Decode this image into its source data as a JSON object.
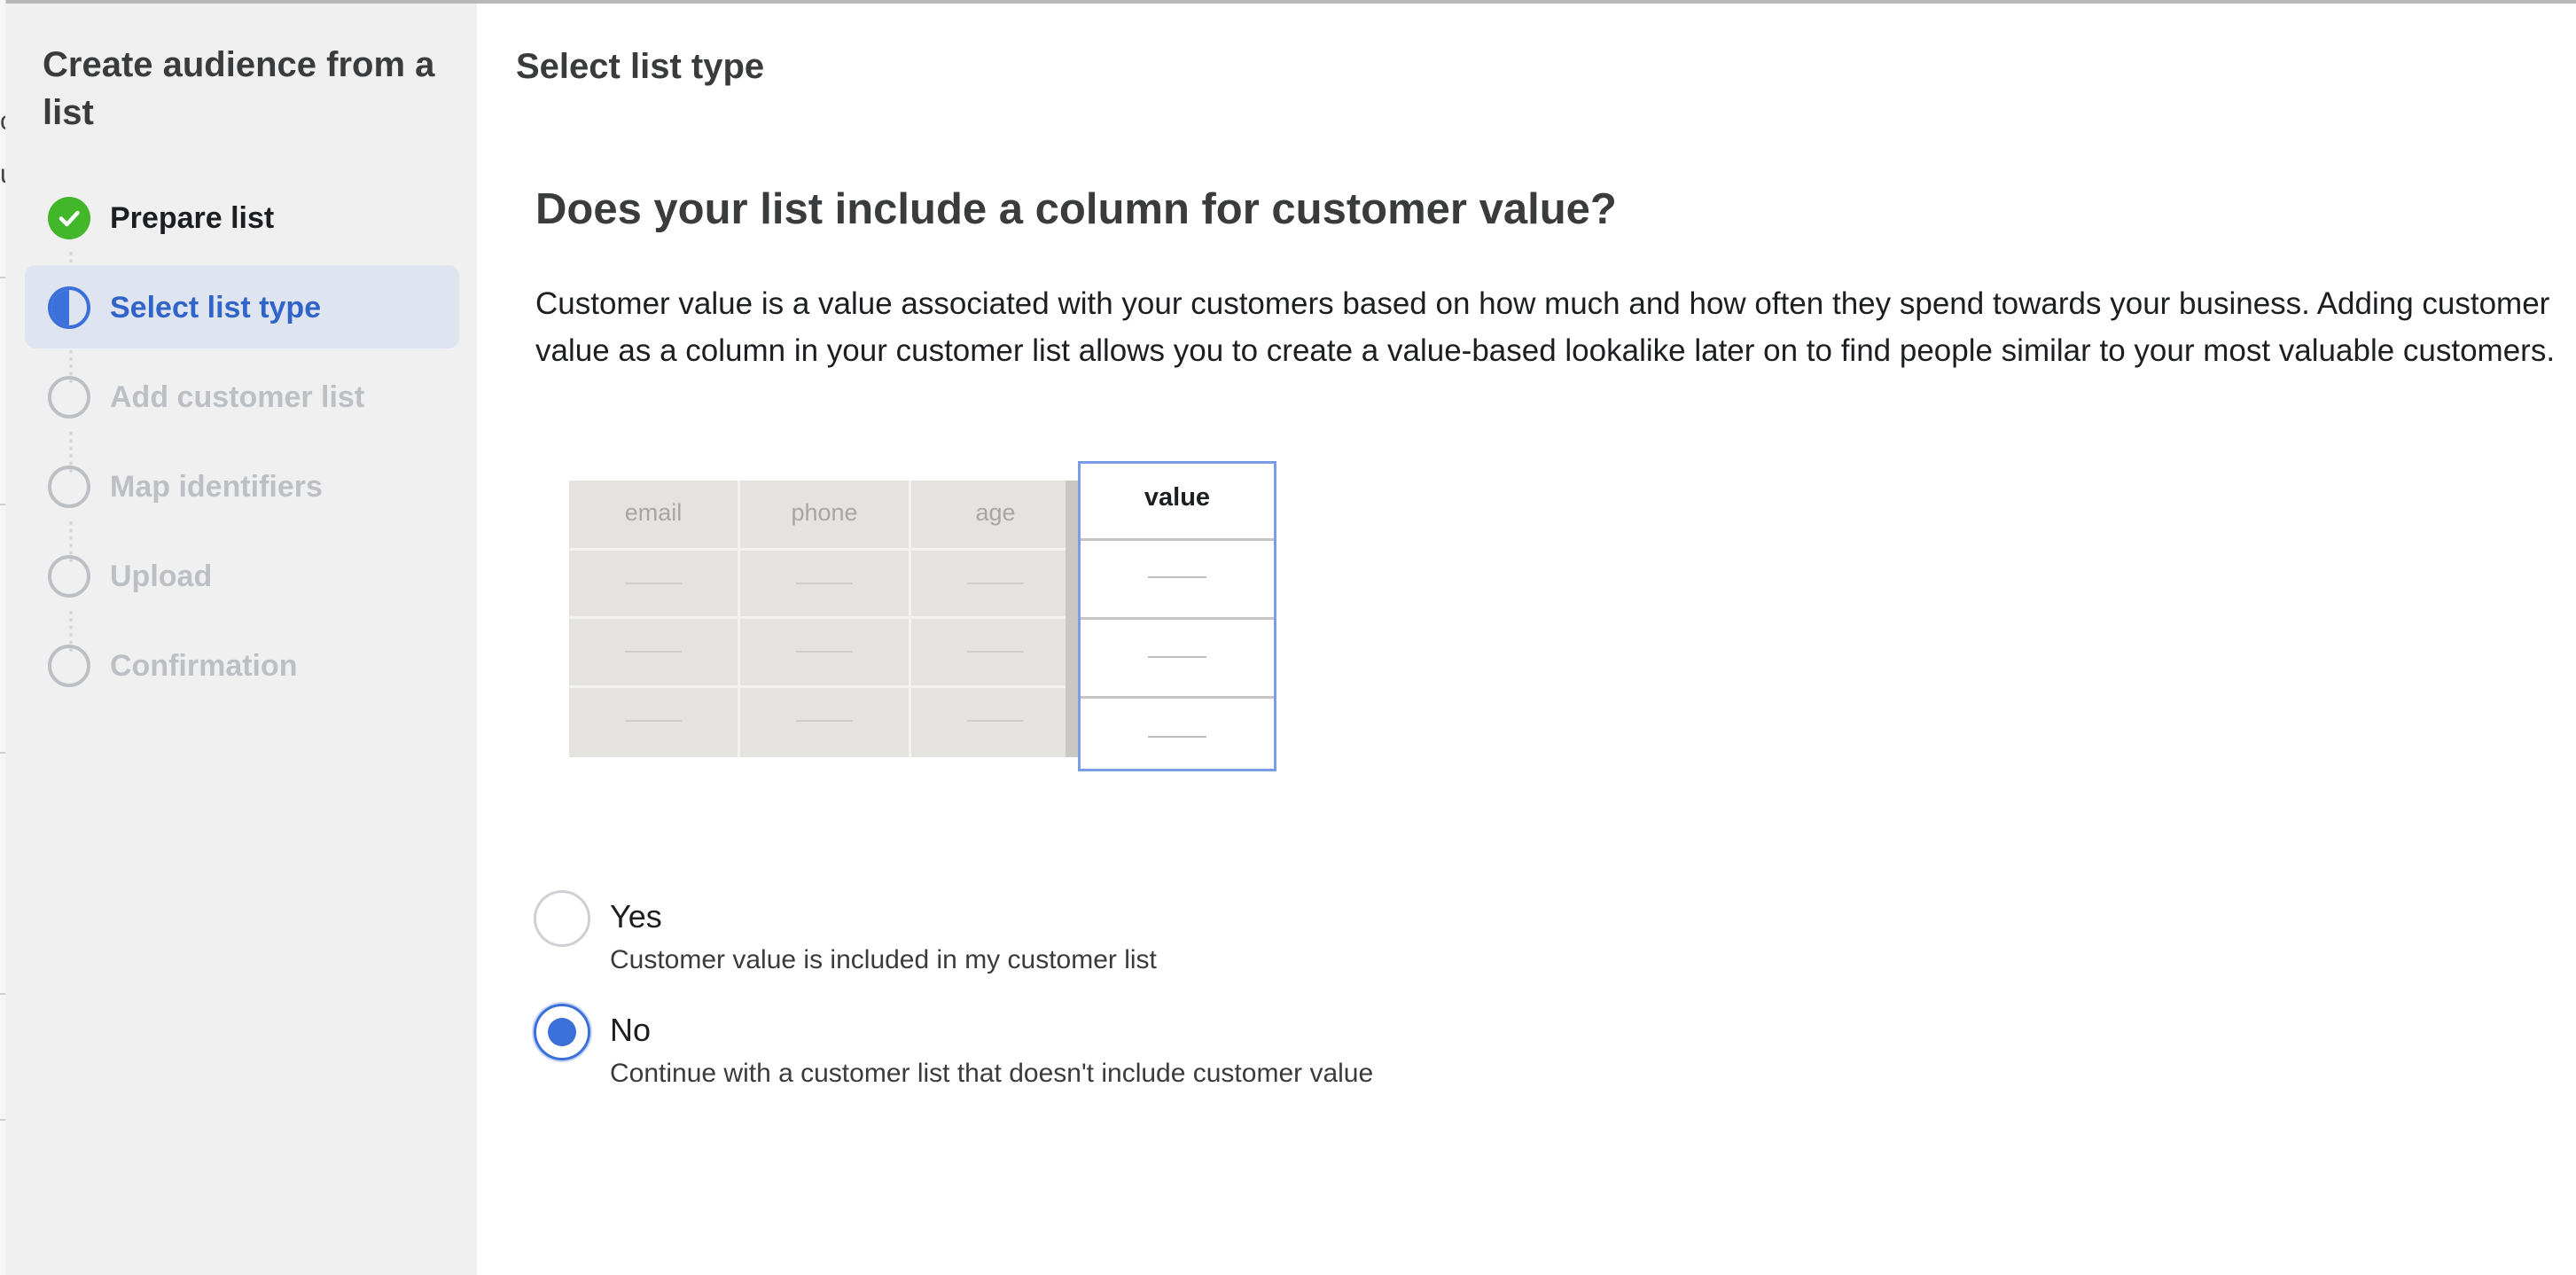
{
  "edge_text": [
    "o",
    "u"
  ],
  "sidebar": {
    "title": "Create audience from a list",
    "steps": [
      {
        "label": "Prepare list",
        "state": "done"
      },
      {
        "label": "Select list type",
        "state": "current"
      },
      {
        "label": "Add customer list",
        "state": "pending"
      },
      {
        "label": "Map identifiers",
        "state": "pending"
      },
      {
        "label": "Upload",
        "state": "pending"
      },
      {
        "label": "Confirmation",
        "state": "pending"
      }
    ]
  },
  "main": {
    "header": "Select list type",
    "question": "Does your list include a column for customer value?",
    "description": "Customer value is a value associated with your customers based on how much and how often they spend towards your business. Adding customer value as a column in your customer list allows you to create a value-based lookalike later on to find people similar to your most valuable customers.",
    "illustration": {
      "columns": [
        "email",
        "phone",
        "age"
      ],
      "value_column": "value"
    },
    "options": [
      {
        "label": "Yes",
        "description": "Customer value is included in my customer list",
        "selected": false
      },
      {
        "label": "No",
        "description": "Continue with a customer list that doesn't include customer value",
        "selected": true
      }
    ]
  },
  "colors": {
    "accent": "#3b6fd9",
    "success": "#42b72a",
    "active_step_bg": "#dfe4f1",
    "sidebar_bg": "#f0f0f0"
  },
  "icons": {
    "done": "check-circle-icon",
    "current": "half-circle-icon",
    "pending": "empty-circle-icon"
  }
}
